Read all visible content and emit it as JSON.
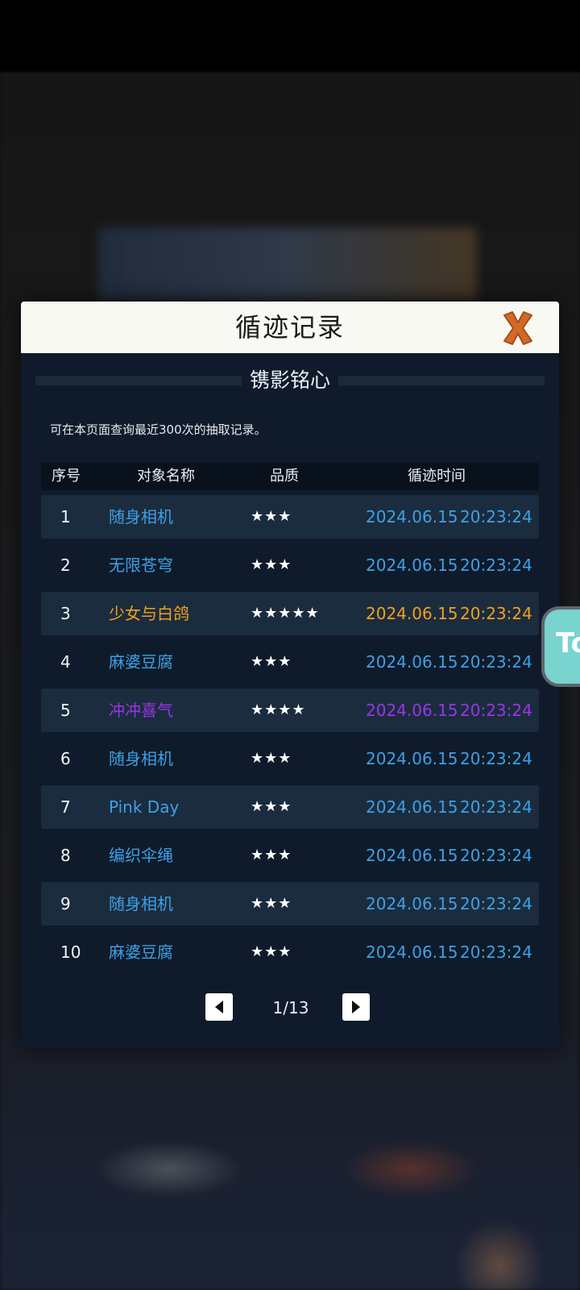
{
  "dialog": {
    "title": "循迹记录",
    "subtitle": "镌影铭心",
    "note": "可在本页面查询最近300次的抽取记录。"
  },
  "table": {
    "headers": [
      "序号",
      "对象名称",
      "品质",
      "循迹时间"
    ],
    "rows": [
      {
        "idx": "1",
        "name": "随身相机",
        "stars": "★★★",
        "date": "2024.06.15",
        "time": "20:23:24",
        "color": "#3ea0e6"
      },
      {
        "idx": "2",
        "name": "无限苍穹",
        "stars": "★★★",
        "date": "2024.06.15",
        "time": "20:23:24",
        "color": "#3ea0e6"
      },
      {
        "idx": "3",
        "name": "少女与白鸽",
        "stars": "★★★★★",
        "date": "2024.06.15",
        "time": "20:23:24",
        "color": "#f2a01e"
      },
      {
        "idx": "4",
        "name": "麻婆豆腐",
        "stars": "★★★",
        "date": "2024.06.15",
        "time": "20:23:24",
        "color": "#3ea0e6"
      },
      {
        "idx": "5",
        "name": "冲冲喜气",
        "stars": "★★★★",
        "date": "2024.06.15",
        "time": "20:23:24",
        "color": "#9a35ea"
      },
      {
        "idx": "6",
        "name": "随身相机",
        "stars": "★★★",
        "date": "2024.06.15",
        "time": "20:23:24",
        "color": "#3ea0e6"
      },
      {
        "idx": "7",
        "name": "Pink Day",
        "stars": "★★★",
        "date": "2024.06.15",
        "time": "20:23:24",
        "color": "#3ea0e6"
      },
      {
        "idx": "8",
        "name": "编织伞绳",
        "stars": "★★★",
        "date": "2024.06.15",
        "time": "20:23:24",
        "color": "#3ea0e6"
      },
      {
        "idx": "9",
        "name": "随身相机",
        "stars": "★★★",
        "date": "2024.06.15",
        "time": "20:23:24",
        "color": "#3ea0e6"
      },
      {
        "idx": "10",
        "name": "麻婆豆腐",
        "stars": "★★★",
        "date": "2024.06.15",
        "time": "20:23:24",
        "color": "#3ea0e6"
      }
    ]
  },
  "pager": {
    "text": "1/13"
  },
  "floating_tab": {
    "label": "To"
  },
  "icons": {
    "close": "close-x-icon",
    "prev": "triangle-left-icon",
    "next": "triangle-right-icon"
  },
  "colors": {
    "rarity_3": "#3ea0e6",
    "rarity_4": "#9a35ea",
    "rarity_5": "#f2a01e",
    "close_x": "#d06a2a"
  }
}
